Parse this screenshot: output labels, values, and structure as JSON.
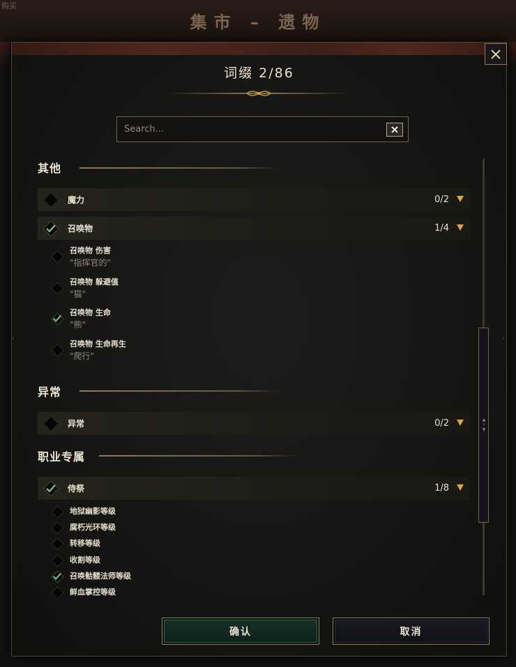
{
  "background": {
    "page_title": "集市 – 遗物",
    "corner_text": "购买"
  },
  "modal": {
    "title": "词缀 2/86",
    "search": {
      "placeholder": "Search...",
      "value": ""
    },
    "icons": {
      "close": "close-icon",
      "clear": "clear-search-icon",
      "check": "checkmark-icon",
      "chevron": "chevron-down-icon"
    },
    "colors": {
      "accent_gold": "#e0a83c",
      "check_green": "#7fc48a",
      "confirm_green": "#173229"
    },
    "sections": [
      {
        "label": "其他",
        "categories": [
          {
            "label": "魔力",
            "count": "0/2",
            "checked": false
          },
          {
            "label": "召唤物",
            "count": "1/4",
            "checked": true,
            "items": [
              {
                "name": "召唤物 伤害",
                "desc": "\"指挥官的\"",
                "checked": false
              },
              {
                "name": "召唤物 躲避值",
                "desc": "\"猫\"",
                "checked": false
              },
              {
                "name": "召唤物 生命",
                "desc": "\"熊\"",
                "checked": true
              },
              {
                "name": "召唤物 生命再生",
                "desc": "\"爬行\"",
                "checked": false
              }
            ]
          }
        ]
      },
      {
        "label": "异常",
        "categories": [
          {
            "label": "异常",
            "count": "0/2",
            "checked": false
          }
        ]
      },
      {
        "label": "职业专属",
        "categories": [
          {
            "label": "侍祭",
            "count": "1/8",
            "checked": true,
            "items": [
              {
                "name": "地狱幽影等级",
                "checked": false
              },
              {
                "name": "腐朽光环等级",
                "checked": false
              },
              {
                "name": "转移等级",
                "checked": false
              },
              {
                "name": "收割等级",
                "checked": false
              },
              {
                "name": "召唤骷髅法师等级",
                "checked": true
              },
              {
                "name": "鲜血掌控等级",
                "checked": false
              }
            ]
          }
        ]
      }
    ],
    "buttons": {
      "confirm": "确认",
      "cancel": "取消"
    }
  }
}
